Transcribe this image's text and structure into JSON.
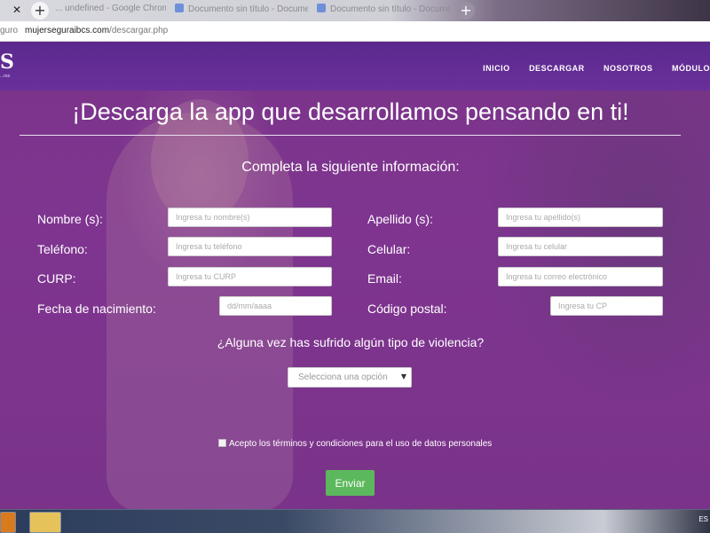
{
  "browser": {
    "tabs": [
      {
        "title": "... undefined - Google Chrome"
      },
      {
        "title": "Documento sin título - Docume"
      },
      {
        "title": "Documento sin título - Docume"
      }
    ],
    "address_prefix": "guro",
    "url_domain": "mujerseguraibcs.com",
    "url_path": "/descargar.php"
  },
  "nav": {
    "logo_text": "S",
    "logo_tagline": "...res",
    "links": [
      "INICIO",
      "DESCARGAR",
      "NOSOTROS",
      "MÓDULO"
    ]
  },
  "page": {
    "headline": "¡Descarga la app que desarrollamos pensando en ti!",
    "subhead": "Completa la siguiente información:"
  },
  "form": {
    "nombre": {
      "label": "Nombre (s):",
      "placeholder": "Ingresa tu nombre(s)"
    },
    "apellido": {
      "label": "Apellido (s):",
      "placeholder": "Ingresa tu apellido(s)"
    },
    "telefono": {
      "label": "Teléfono:",
      "placeholder": "Ingresa tu teléfono"
    },
    "celular": {
      "label": "Celular:",
      "placeholder": "Ingresa tu celular"
    },
    "curp": {
      "label": "CURP:",
      "placeholder": "Ingresa tu CURP"
    },
    "email": {
      "label": "Email:",
      "placeholder": "Ingresa tu correo electrónico"
    },
    "fecha": {
      "label": "Fecha de nacimiento:",
      "placeholder": "dd/mm/aaaa"
    },
    "cp": {
      "label": "Código postal:",
      "placeholder": "Ingresa tu CP"
    },
    "question": "¿Alguna vez has sufrido algún tipo de violencia?",
    "select_value": "Selecciona una opción",
    "terms": "Acepto los términos y condiciones para el uso de datos personales",
    "submit": "Enviar"
  },
  "taskbar": {
    "lang": "ES"
  },
  "colors": {
    "nav_bg": "#5b2a8e",
    "page_bg": "#7a3489",
    "submit_bg": "#5cb85c"
  }
}
